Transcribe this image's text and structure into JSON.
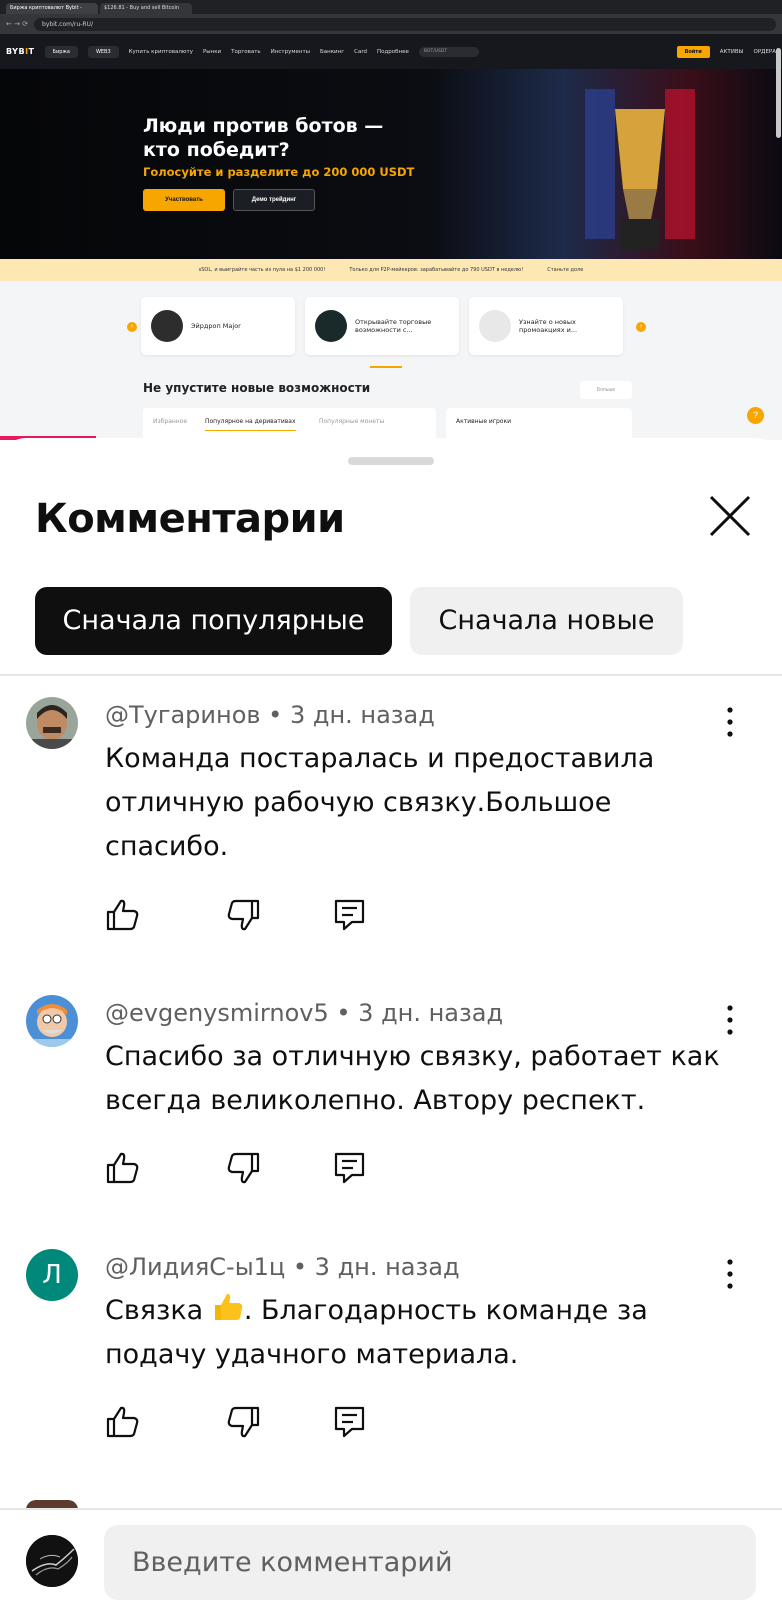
{
  "browser": {
    "tabs": [
      "Биржа криптовалют Bybit -",
      "$126.81 - Buy and sell Bitcoin"
    ],
    "url": "bybit.com/ru-RU/"
  },
  "bybit": {
    "logo": "BYBIT",
    "nav_pills": [
      "Биржа",
      "WEB3"
    ],
    "nav_links": [
      "Купить криптовалюту",
      "Рынки",
      "Торговать",
      "Инструменты",
      "Банкинг",
      "Card",
      "Подробнее"
    ],
    "search_placeholder": "BOT/USDT",
    "login": "Войти",
    "right_links": [
      "АКТИВЫ",
      "ОРДЕРА"
    ],
    "hero_title": "Люди против ботов — кто победит?",
    "hero_subtitle": "Голосуйте и разделите до 200 000 USDT",
    "hero_primary": "Участвовать",
    "hero_secondary": "Демо трейдинг",
    "promo_items": [
      "sSOL, и выиграйте часть из пула на $1 200 000!",
      "Только для P2P-мейкеров: зарабатывайте до 790 USDT в неделю!",
      "Станьте доле"
    ],
    "cards": [
      "Эйрдроп Major",
      "Открывайте торговые возможности с...",
      "Узнайте о новых промоакциях и..."
    ],
    "section_title": "Не упустите новые возможности",
    "more": "Больше",
    "panel_tabs": [
      "Избранное",
      "Популярное на деривативах",
      "Популярные монеты"
    ],
    "panel_b_tab": "Активные игроки"
  },
  "sheet": {
    "title": "Комментарии",
    "sort_chips": [
      "Сначала популярные",
      "Сначала новые"
    ]
  },
  "comments": [
    {
      "author": "@Тугаринов",
      "time": "3 дн. назад",
      "text": "Команда постаралась и предоставила отличную рабочую связку.Большое спасибо."
    },
    {
      "author": "@evgenysmirnov5",
      "time": "3 дн. назад",
      "text": "Спасибо за отличную связку, работает как всегда великолепно. Автору респект."
    },
    {
      "author": "@ЛидияС-ы1ц",
      "time": "3 дн. назад",
      "avatar_letter": "Л",
      "text_before": "Связка ",
      "text_after": ". Благодарность команде за подачу удачного  материала."
    }
  ],
  "input": {
    "placeholder": "Введите комментарий"
  },
  "icons": [
    "like-icon",
    "dislike-icon",
    "reply-icon",
    "more-icon",
    "close-icon",
    "thumbs-up-emoji"
  ],
  "colors": {
    "chip_active": "#0f0f0f",
    "chip_inactive": "#f0f0f0",
    "bybit_accent": "#f7a600",
    "avatar_l": "#00897b"
  }
}
